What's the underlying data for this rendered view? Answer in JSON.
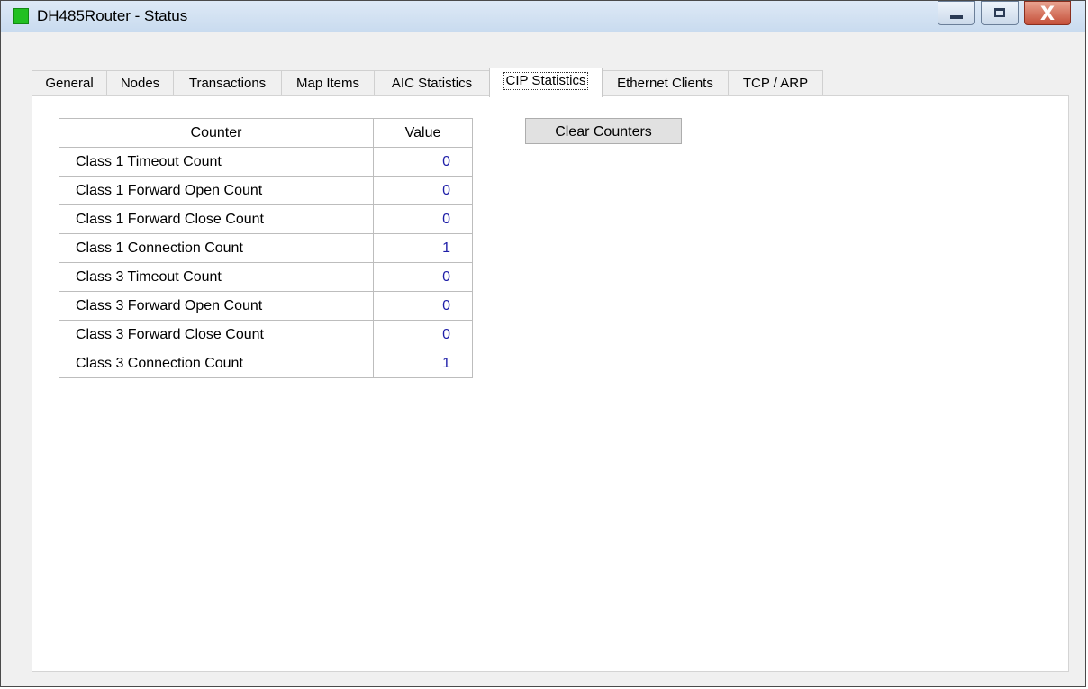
{
  "window": {
    "title": "DH485Router - Status",
    "icon": "green-square-icon",
    "controls": {
      "minimize": "minimize-icon",
      "maximize": "maximize-icon",
      "close_glyph": "X"
    }
  },
  "tabs": [
    {
      "label": "General",
      "active": false
    },
    {
      "label": "Nodes",
      "active": false
    },
    {
      "label": "Transactions",
      "active": false
    },
    {
      "label": "Map Items",
      "active": false
    },
    {
      "label": "AIC Statistics",
      "active": false
    },
    {
      "label": "CIP Statistics",
      "active": true
    },
    {
      "label": "Ethernet Clients",
      "active": false
    },
    {
      "label": "TCP / ARP",
      "active": false
    }
  ],
  "table": {
    "headers": {
      "counter": "Counter",
      "value": "Value"
    },
    "rows": [
      {
        "counter": "Class 1 Timeout Count",
        "value": "0"
      },
      {
        "counter": "Class 1 Forward Open Count",
        "value": "0"
      },
      {
        "counter": "Class 1 Forward Close Count",
        "value": "0"
      },
      {
        "counter": "Class 1 Connection Count",
        "value": "1"
      },
      {
        "counter": "Class 3 Timeout Count",
        "value": "0"
      },
      {
        "counter": "Class 3 Forward Open Count",
        "value": "0"
      },
      {
        "counter": "Class 3 Forward Close Count",
        "value": "0"
      },
      {
        "counter": "Class 3 Connection Count",
        "value": "1"
      }
    ]
  },
  "actions": {
    "clear_counters": "Clear Counters"
  },
  "colors": {
    "value_text": "#1e1ea8",
    "title_icon": "#22c022",
    "close_button": "#c5503a"
  }
}
